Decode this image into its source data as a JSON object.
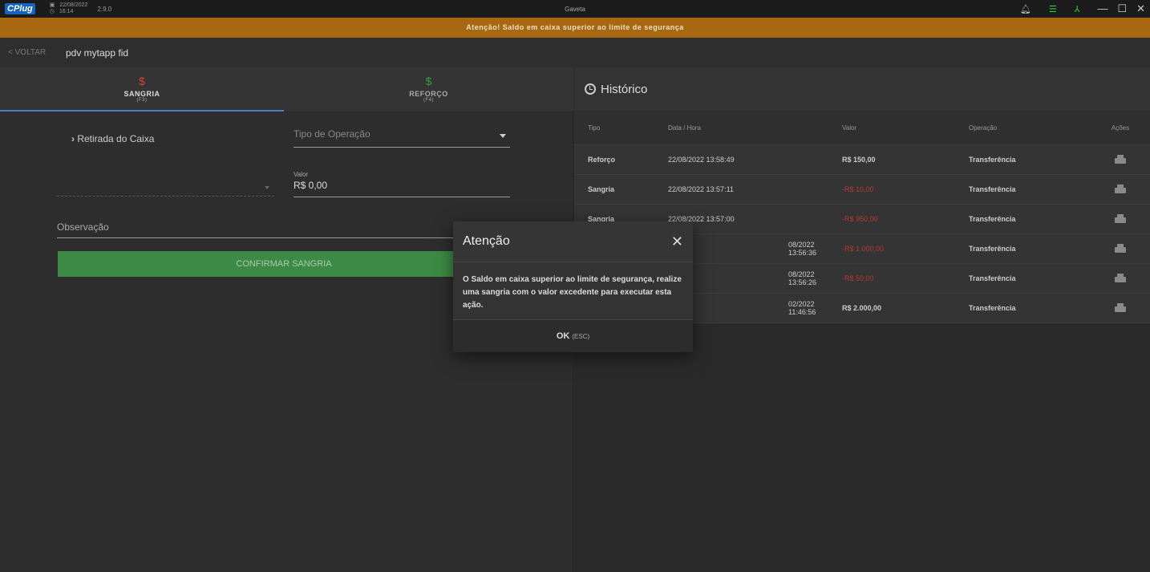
{
  "titlebar": {
    "logo": "CPlug",
    "date": "22/08/2022",
    "time": "16:14",
    "version": "2.9.0",
    "title": "Gaveta"
  },
  "banner": "Atenção! Saldo em caixa superior ao limite de segurança",
  "nav": {
    "back_label": "< VOLTAR",
    "store_name": "pdv mytapp fid"
  },
  "tabs": [
    {
      "symbol": "$",
      "label": "SANGRIA",
      "key": "(F3)",
      "color": "#d0443a"
    },
    {
      "symbol": "$",
      "label": "REFORÇO",
      "key": "(F4)",
      "color": "#3c9a44"
    }
  ],
  "form": {
    "retirada_label": "Retirada do Caixa",
    "tipo_placeholder": "Tipo de Operação",
    "valor_label": "Valor",
    "valor_value": "R$ 0,00",
    "obs_placeholder": "Observação",
    "confirm_label": "CONFIRMAR SANGRIA"
  },
  "historico": {
    "title": "Histórico",
    "columns": [
      "Tipo",
      "Data / Hora",
      "Valor",
      "Operação",
      "Ações"
    ],
    "rows": [
      {
        "tipo": "Reforço",
        "data": "22/08/2022 13:58:49",
        "valor": "R$ 150,00",
        "operacao": "Transferência",
        "negative": false
      },
      {
        "tipo": "Sangria",
        "data": "22/08/2022 13:57:11",
        "valor": "-R$ 10,00",
        "operacao": "Transferência",
        "negative": true
      },
      {
        "tipo": "Sangria",
        "data": "22/08/2022 13:57:00",
        "valor": "-R$ 950,00",
        "operacao": "Transferência",
        "negative": true
      },
      {
        "tipo": "",
        "data": "08/2022 13:56:36",
        "valor": "-R$ 1.000,00",
        "operacao": "Transferência",
        "negative": true
      },
      {
        "tipo": "",
        "data": "08/2022 13:56:26",
        "valor": "-R$ 50,00",
        "operacao": "Transferência",
        "negative": true
      },
      {
        "tipo": "",
        "data": "02/2022 11:46:56",
        "valor": "R$ 2.000,00",
        "operacao": "Transferência",
        "negative": false
      }
    ]
  },
  "dialog": {
    "title": "Atenção",
    "close": "✕",
    "body": "O Saldo em caixa superior ao limite de segurança, realize uma sangria com o valor excedente para executar esta ação.",
    "ok_label": "OK",
    "ok_hint": "(ESC)"
  }
}
